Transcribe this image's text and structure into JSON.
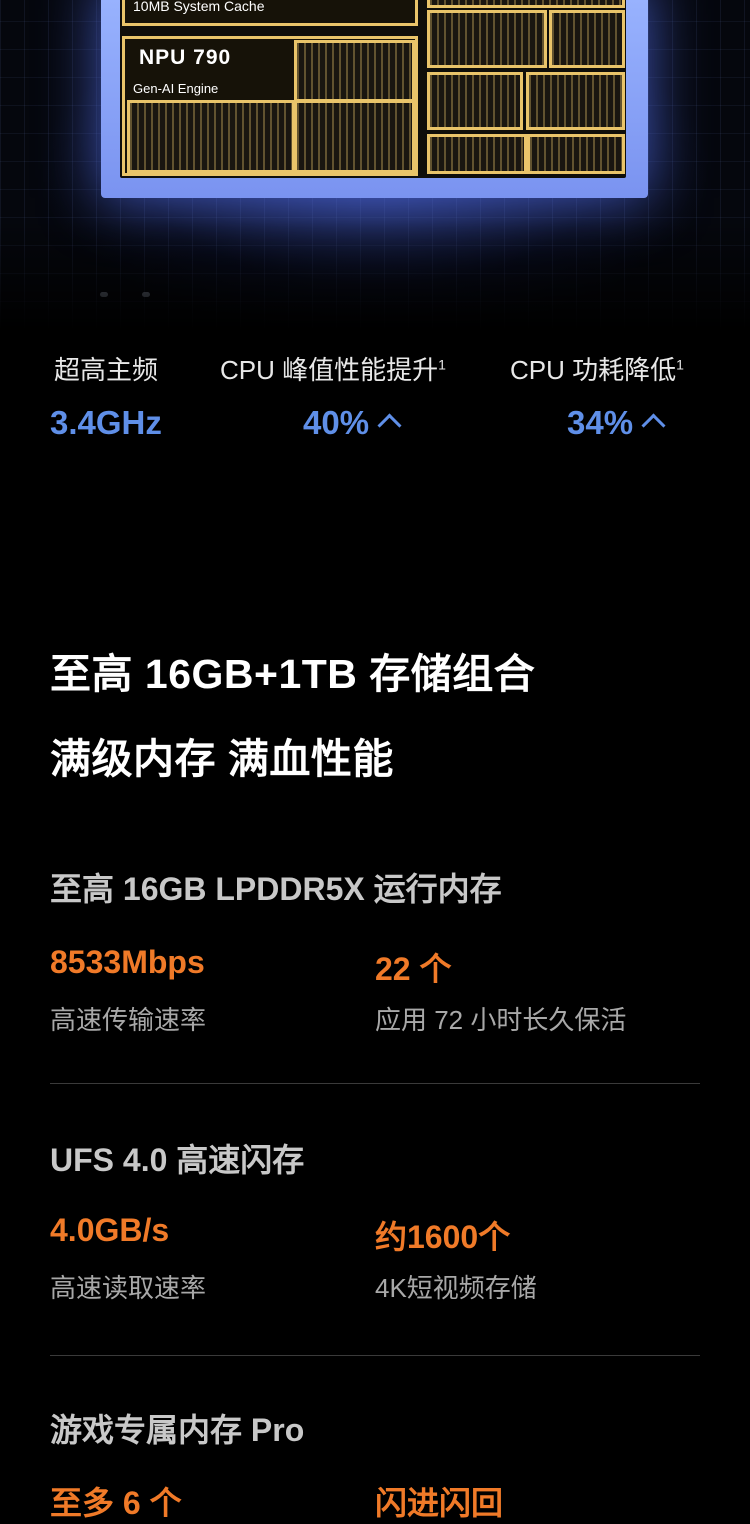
{
  "chip": {
    "cache_label": "10MB System Cache",
    "npu_name": "NPU 790",
    "npu_sub": "Gen-AI Engine"
  },
  "stats": [
    {
      "label": "超高主频",
      "value": "3.4GHz",
      "sup": "",
      "arrow": false
    },
    {
      "label": "CPU 峰值性能提升",
      "sup": "1",
      "value": "40%",
      "arrow": true
    },
    {
      "label": "CPU 功耗降低",
      "sup": "1",
      "value": "34%",
      "arrow": true
    }
  ],
  "headline": {
    "line1": "至高 16GB+1TB 存储组合",
    "line2": "满级内存 满血性能"
  },
  "sections": [
    {
      "title": "至高 16GB LPDDR5X 运行内存",
      "left": {
        "value": "8533Mbps",
        "desc": "高速传输速率"
      },
      "right": {
        "value": "22 个",
        "desc": "应用 72 小时长久保活"
      }
    },
    {
      "title": "UFS 4.0 高速闪存",
      "left": {
        "value": "4.0GB/s",
        "desc": "高速读取速率"
      },
      "right": {
        "value": "约1600个",
        "desc": "4K短视频存储"
      }
    },
    {
      "title": "游戏专属内存 Pro",
      "left": {
        "value": "至多 6 个",
        "desc": ""
      },
      "right": {
        "value": "闪进闪回",
        "desc": ""
      }
    }
  ],
  "colors": {
    "accent_blue": "#5f8fe8",
    "accent_orange": "#f07a28",
    "chip_gold": "#e9c46a",
    "chip_frame": "#9bb5ff"
  }
}
